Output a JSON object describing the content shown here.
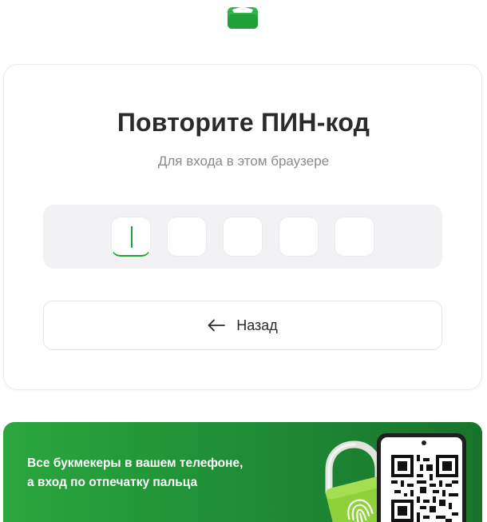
{
  "header": {
    "logo_icon": "wallet-logo-icon",
    "brand_color": "#21a038"
  },
  "pin_screen": {
    "title": "Повторите ПИН-код",
    "subtitle": "Для входа в этом браузере",
    "pin_length": 5,
    "entered_digits": 0,
    "active_index": 0,
    "back_icon": "arrow-left-icon",
    "back_label": "Назад"
  },
  "promo": {
    "text_line1": "Все букмекеры в вашем телефоне,",
    "text_line2": "а вход по отпечатку пальца",
    "lock_icon": "fingerprint-lock-icon",
    "qr_icon": "qr-code-icon",
    "gradient_from": "#2aa73d",
    "gradient_to": "#17742b"
  }
}
